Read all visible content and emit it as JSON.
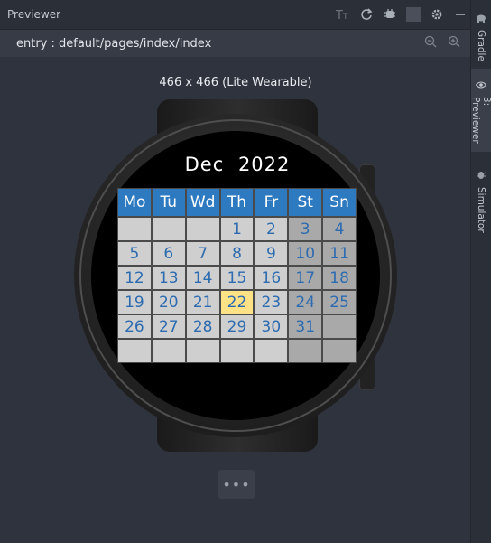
{
  "panel": {
    "title": "Previewer",
    "toolbar_icons": [
      "font-size-icon",
      "refresh-icon",
      "deploy-icon",
      "gear-icon",
      "minimize-icon"
    ]
  },
  "pathbar": {
    "path": "entry : default/pages/index/index",
    "zoom_icons": [
      "zoom-out-icon",
      "zoom-in-icon"
    ]
  },
  "sidebar": {
    "tabs": [
      {
        "label": "Gradle",
        "icon": "elephant-icon"
      },
      {
        "label": "3: Previewer",
        "icon": "eye-icon"
      },
      {
        "label": "Simulator",
        "icon": "bug-icon"
      }
    ]
  },
  "device": {
    "label": "466 x 466 (Lite Wearable)"
  },
  "calendar": {
    "month": "Dec",
    "year": "2022",
    "weekdays": [
      "Mo",
      "Tu",
      "Wd",
      "Th",
      "Fr",
      "St",
      "Sn"
    ],
    "rows": [
      [
        "",
        "",
        "",
        "1",
        "2",
        "3",
        "4"
      ],
      [
        "5",
        "6",
        "7",
        "8",
        "9",
        "10",
        "11"
      ],
      [
        "12",
        "13",
        "14",
        "15",
        "16",
        "17",
        "18"
      ],
      [
        "19",
        "20",
        "21",
        "22",
        "23",
        "24",
        "25"
      ],
      [
        "26",
        "27",
        "28",
        "29",
        "30",
        "31",
        ""
      ],
      [
        "",
        "",
        "",
        "",
        "",
        "",
        ""
      ]
    ],
    "today": "22",
    "colors": {
      "header": "#2e7ac0",
      "cell": "#cfcfcf",
      "weekend": "#a9a9a9",
      "today": "#ffe186",
      "number": "#2c6bb0"
    }
  },
  "more_button": {
    "label": "•••"
  }
}
